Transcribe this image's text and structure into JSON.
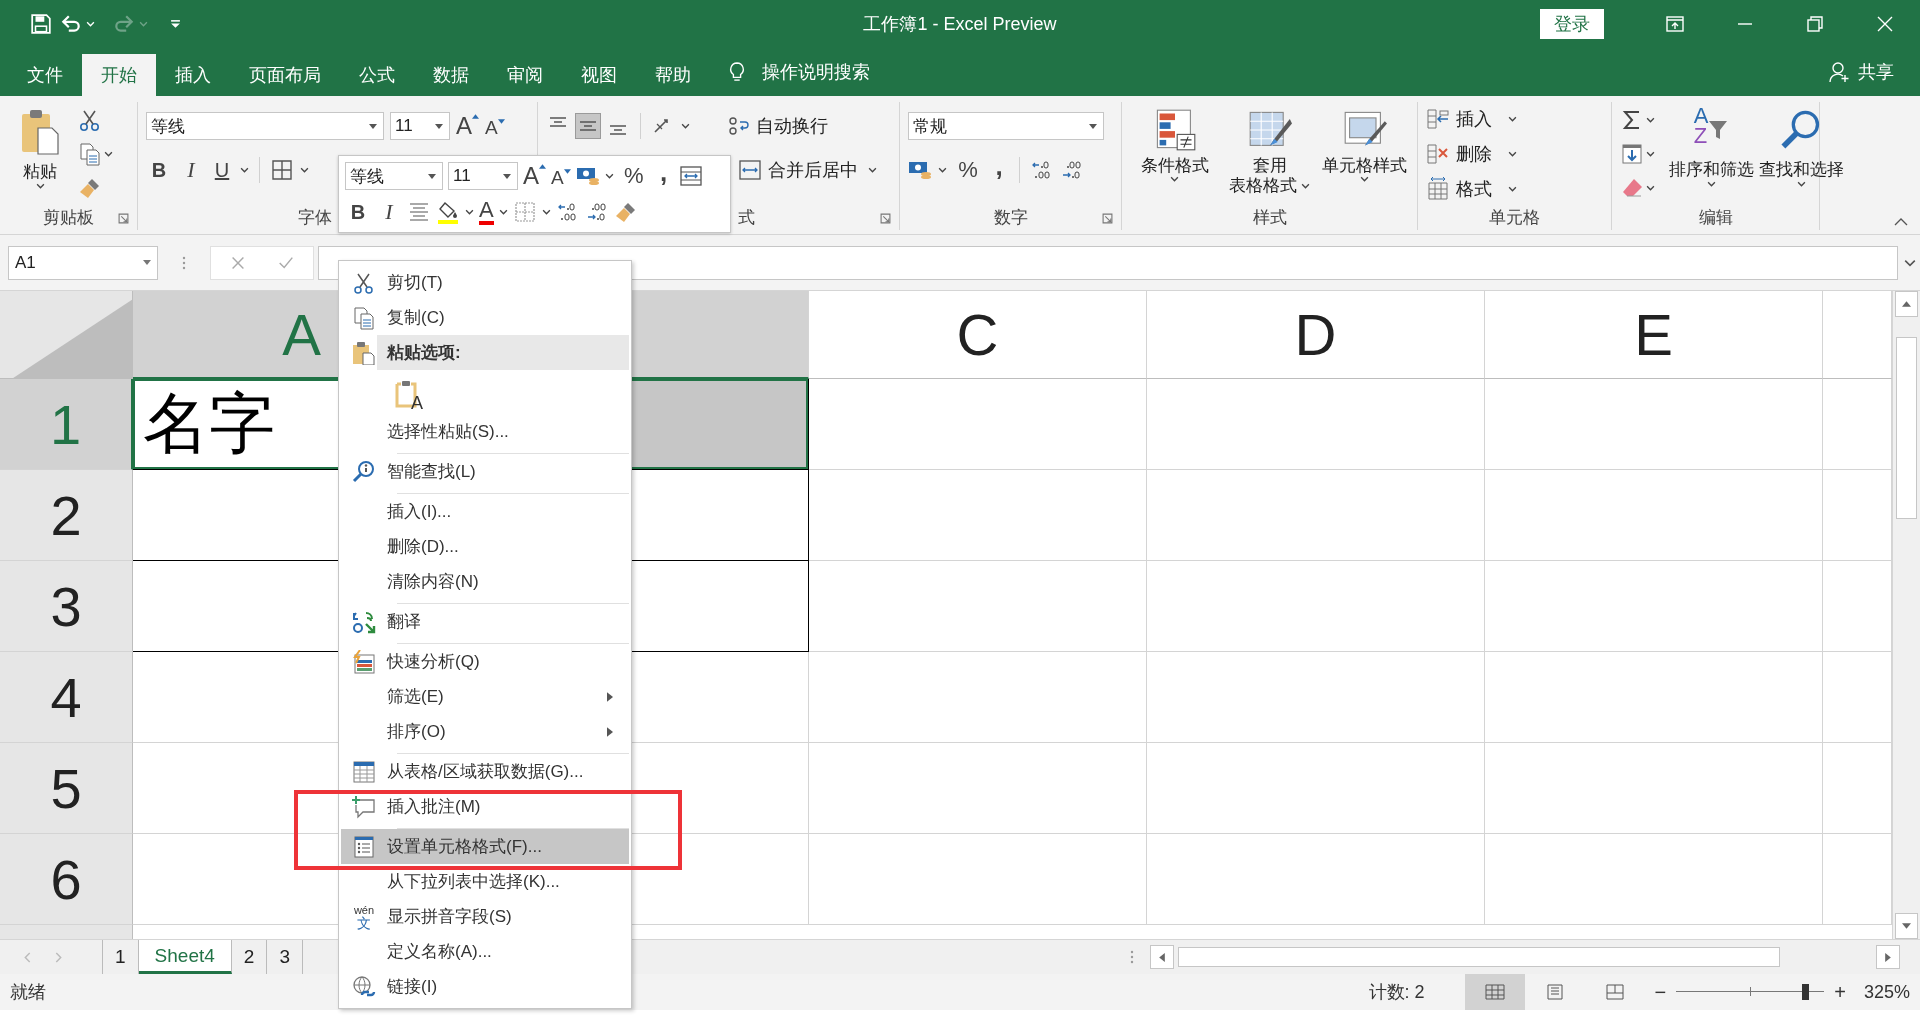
{
  "title_bar": {
    "title": "工作簿1  -  Excel Preview",
    "sign_in": "登录"
  },
  "tabs": [
    {
      "label": "文件",
      "selected": false
    },
    {
      "label": "开始",
      "selected": true
    },
    {
      "label": "插入",
      "selected": false
    },
    {
      "label": "页面布局",
      "selected": false
    },
    {
      "label": "公式",
      "selected": false
    },
    {
      "label": "数据",
      "selected": false
    },
    {
      "label": "审阅",
      "selected": false
    },
    {
      "label": "视图",
      "selected": false
    },
    {
      "label": "帮助",
      "selected": false
    }
  ],
  "tell_me": "操作说明搜索",
  "share": "共享",
  "ribbon": {
    "clipboard": {
      "paste": "粘贴",
      "label": "剪贴板"
    },
    "font": {
      "name": "等线",
      "size": "11",
      "grow": "A",
      "shrink": "A",
      "bold": "B",
      "italic": "I",
      "underline": "U",
      "label": "字体"
    },
    "alignment": {
      "wrap_text": "自动换行",
      "merge_center": "合并后居中",
      "label": "式"
    },
    "number": {
      "format": "常规",
      "percent": "%",
      "comma": ",",
      "label": "数字"
    },
    "styles": {
      "buttons": [
        {
          "lines": [
            "条件格式"
          ]
        },
        {
          "lines": [
            "套用",
            "表格格式"
          ]
        },
        {
          "lines": [
            "单元格样式"
          ]
        }
      ],
      "label": "样式"
    },
    "cells": {
      "buttons": [
        {
          "label": "插入"
        },
        {
          "label": "删除"
        },
        {
          "label": "格式"
        }
      ],
      "label": "单元格"
    },
    "editing": {
      "sort_letters": [
        "A",
        "Z"
      ],
      "sort_filter": "排序和筛选",
      "find_select": "查找和选择",
      "label": "编辑"
    }
  },
  "mini_toolbar": {
    "font": "等线",
    "size": "11",
    "grow": "A",
    "shrink": "A",
    "percent": "%",
    "comma": ",",
    "bold": "B",
    "italic": "I",
    "font_color": "A"
  },
  "formula_bar": {
    "name_box": "A1"
  },
  "sheet": {
    "columns": [
      {
        "label": "A",
        "selected": true
      },
      {
        "selected": true
      },
      {
        "label": "C",
        "selected": false
      },
      {
        "label": "D",
        "selected": false
      },
      {
        "label": "E",
        "selected": false
      }
    ],
    "rows": [
      {
        "label": "1",
        "selected": true,
        "cells": [
          {
            "text": "名字",
            "bordered": true,
            "selected": false,
            "active": true
          },
          {
            "bordered": true,
            "selected": true,
            "active": false
          },
          {
            "bordered": false,
            "selected": false,
            "active": false
          },
          {
            "bordered": false,
            "selected": false,
            "active": false
          },
          {
            "bordered": false,
            "selected": false,
            "active": false
          }
        ]
      },
      {
        "label": "2",
        "selected": false,
        "cells": [
          {
            "bordered": true,
            "selected": false,
            "active": false
          },
          {
            "bordered": true,
            "selected": false,
            "active": false
          },
          {
            "bordered": false,
            "selected": false,
            "active": false
          },
          {
            "bordered": false,
            "selected": false,
            "active": false
          },
          {
            "bordered": false,
            "selected": false,
            "active": false
          }
        ]
      },
      {
        "label": "3",
        "selected": false,
        "cells": [
          {
            "bordered": true,
            "selected": false,
            "active": false
          },
          {
            "bordered": true,
            "selected": false,
            "active": false
          },
          {
            "bordered": false,
            "selected": false,
            "active": false
          },
          {
            "bordered": false,
            "selected": false,
            "active": false
          },
          {
            "bordered": false,
            "selected": false,
            "active": false
          }
        ]
      },
      {
        "label": "4",
        "selected": false,
        "cells": [
          {
            "bordered": false,
            "selected": false,
            "active": false
          },
          {
            "bordered": false,
            "selected": false,
            "active": false
          },
          {
            "bordered": false,
            "selected": false,
            "active": false
          },
          {
            "bordered": false,
            "selected": false,
            "active": false
          },
          {
            "bordered": false,
            "selected": false,
            "active": false
          }
        ]
      },
      {
        "label": "5",
        "selected": false,
        "cells": [
          {
            "bordered": false,
            "selected": false,
            "active": false
          },
          {
            "bordered": false,
            "selected": false,
            "active": false
          },
          {
            "bordered": false,
            "selected": false,
            "active": false
          },
          {
            "bordered": false,
            "selected": false,
            "active": false
          },
          {
            "bordered": false,
            "selected": false,
            "active": false
          }
        ]
      },
      {
        "label": "6",
        "selected": false,
        "cells": [
          {
            "bordered": false,
            "selected": false,
            "active": false
          },
          {
            "bordered": false,
            "selected": false,
            "active": false
          },
          {
            "bordered": false,
            "selected": false,
            "active": false
          },
          {
            "bordered": false,
            "selected": false,
            "active": false
          },
          {
            "bordered": false,
            "selected": false,
            "active": false
          }
        ]
      }
    ]
  },
  "context_menu": {
    "items": [
      {
        "kind": "item",
        "label": "剪切(T)",
        "submenu": false,
        "selected": false,
        "separator_after": false
      },
      {
        "kind": "item",
        "label": "复制(C)",
        "submenu": false,
        "selected": false,
        "separator_after": false
      },
      {
        "kind": "header",
        "label": "粘贴选项:",
        "separator_after": false
      },
      {
        "kind": "paste-options",
        "option": "A"
      },
      {
        "kind": "item",
        "label": "选择性粘贴(S)...",
        "submenu": false,
        "selected": false,
        "separator_after": true
      },
      {
        "kind": "item",
        "label": "智能查找(L)",
        "submenu": false,
        "selected": false,
        "separator_after": true
      },
      {
        "kind": "item",
        "label": "插入(I)...",
        "submenu": false,
        "selected": false,
        "separator_after": false
      },
      {
        "kind": "item",
        "label": "删除(D)...",
        "submenu": false,
        "selected": false,
        "separator_after": false
      },
      {
        "kind": "item",
        "label": "清除内容(N)",
        "submenu": false,
        "selected": false,
        "separator_after": true
      },
      {
        "kind": "item",
        "label": "翻译",
        "submenu": false,
        "selected": false,
        "separator_after": true
      },
      {
        "kind": "item",
        "label": "快速分析(Q)",
        "submenu": false,
        "selected": false,
        "separator_after": false
      },
      {
        "kind": "item",
        "label": "筛选(E)",
        "submenu": true,
        "selected": false,
        "separator_after": false
      },
      {
        "kind": "item",
        "label": "排序(O)",
        "submenu": true,
        "selected": false,
        "separator_after": true
      },
      {
        "kind": "item",
        "label": "从表格/区域获取数据(G)...",
        "submenu": false,
        "selected": false,
        "separator_after": false
      },
      {
        "kind": "item",
        "label": "插入批注(M)",
        "submenu": false,
        "selected": false,
        "separator_after": true
      },
      {
        "kind": "item",
        "label": "设置单元格格式(F)...",
        "submenu": false,
        "selected": true,
        "separator_after": false
      },
      {
        "kind": "item",
        "label": "从下拉列表中选择(K)...",
        "submenu": false,
        "selected": false,
        "separator_after": false
      },
      {
        "kind": "item",
        "icon_text": [
          "wén",
          "文"
        ],
        "label": "显示拼音字段(S)",
        "submenu": false,
        "selected": false,
        "separator_after": false
      },
      {
        "kind": "item",
        "label": "定义名称(A)...",
        "submenu": false,
        "selected": false,
        "separator_after": false
      },
      {
        "kind": "item",
        "label": "链接(I)",
        "submenu": false,
        "selected": false,
        "separator_after": false
      }
    ]
  },
  "sheet_tabs": [
    {
      "label": "1",
      "selected": false
    },
    {
      "label": "Sheet4",
      "selected": true
    },
    {
      "label": "2",
      "selected": false
    },
    {
      "label": "3",
      "selected": false
    }
  ],
  "status_bar": {
    "status": "就绪",
    "count": "计数: 2",
    "views": [
      {
        "kind": "normal",
        "selected": true
      },
      {
        "kind": "page-layout",
        "selected": false
      },
      {
        "kind": "page-break",
        "selected": false
      }
    ],
    "zoom_out": "−",
    "zoom_in": "+",
    "zoom": {
      "level": 0.87
    },
    "zoom_text": "325%"
  },
  "annotation": {
    "kind": "frame"
  }
}
